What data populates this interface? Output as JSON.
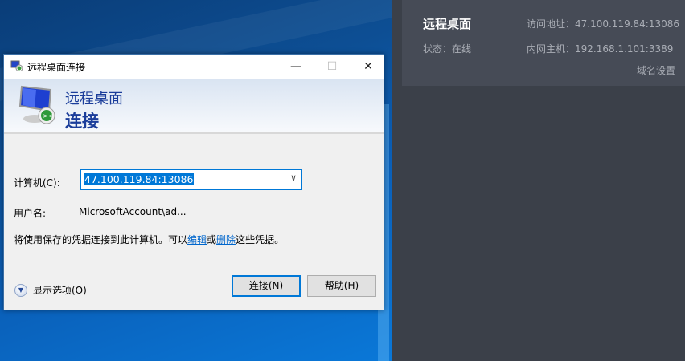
{
  "panel": {
    "title": "远程桌面",
    "status": "状态：在线",
    "access_address": "访问地址：47.100.119.84:13086",
    "lan_host": "内网主机：192.168.1.101:3389",
    "domain_settings": "域名设置"
  },
  "dialog": {
    "window_title": "远程桌面连接",
    "controls": {
      "minimize": "—",
      "maximize": "☐",
      "close": "✕"
    },
    "header_line1": "远程桌面",
    "header_line2": "连接",
    "computer_label": "计算机(C):",
    "computer_value": "47.100.119.84:13086",
    "username_label": "用户名:",
    "username_value": "MicrosoftAccount\\ad...",
    "cred_text_before": "将使用保存的凭据连接到此计算机。可以",
    "cred_edit_link": "编辑",
    "cred_or": "或",
    "cred_delete_link": "删除",
    "cred_text_after": "这些凭据。",
    "show_options": "显示选项(O)",
    "connect_button": "连接(N)",
    "help_button": "帮助(H)"
  }
}
